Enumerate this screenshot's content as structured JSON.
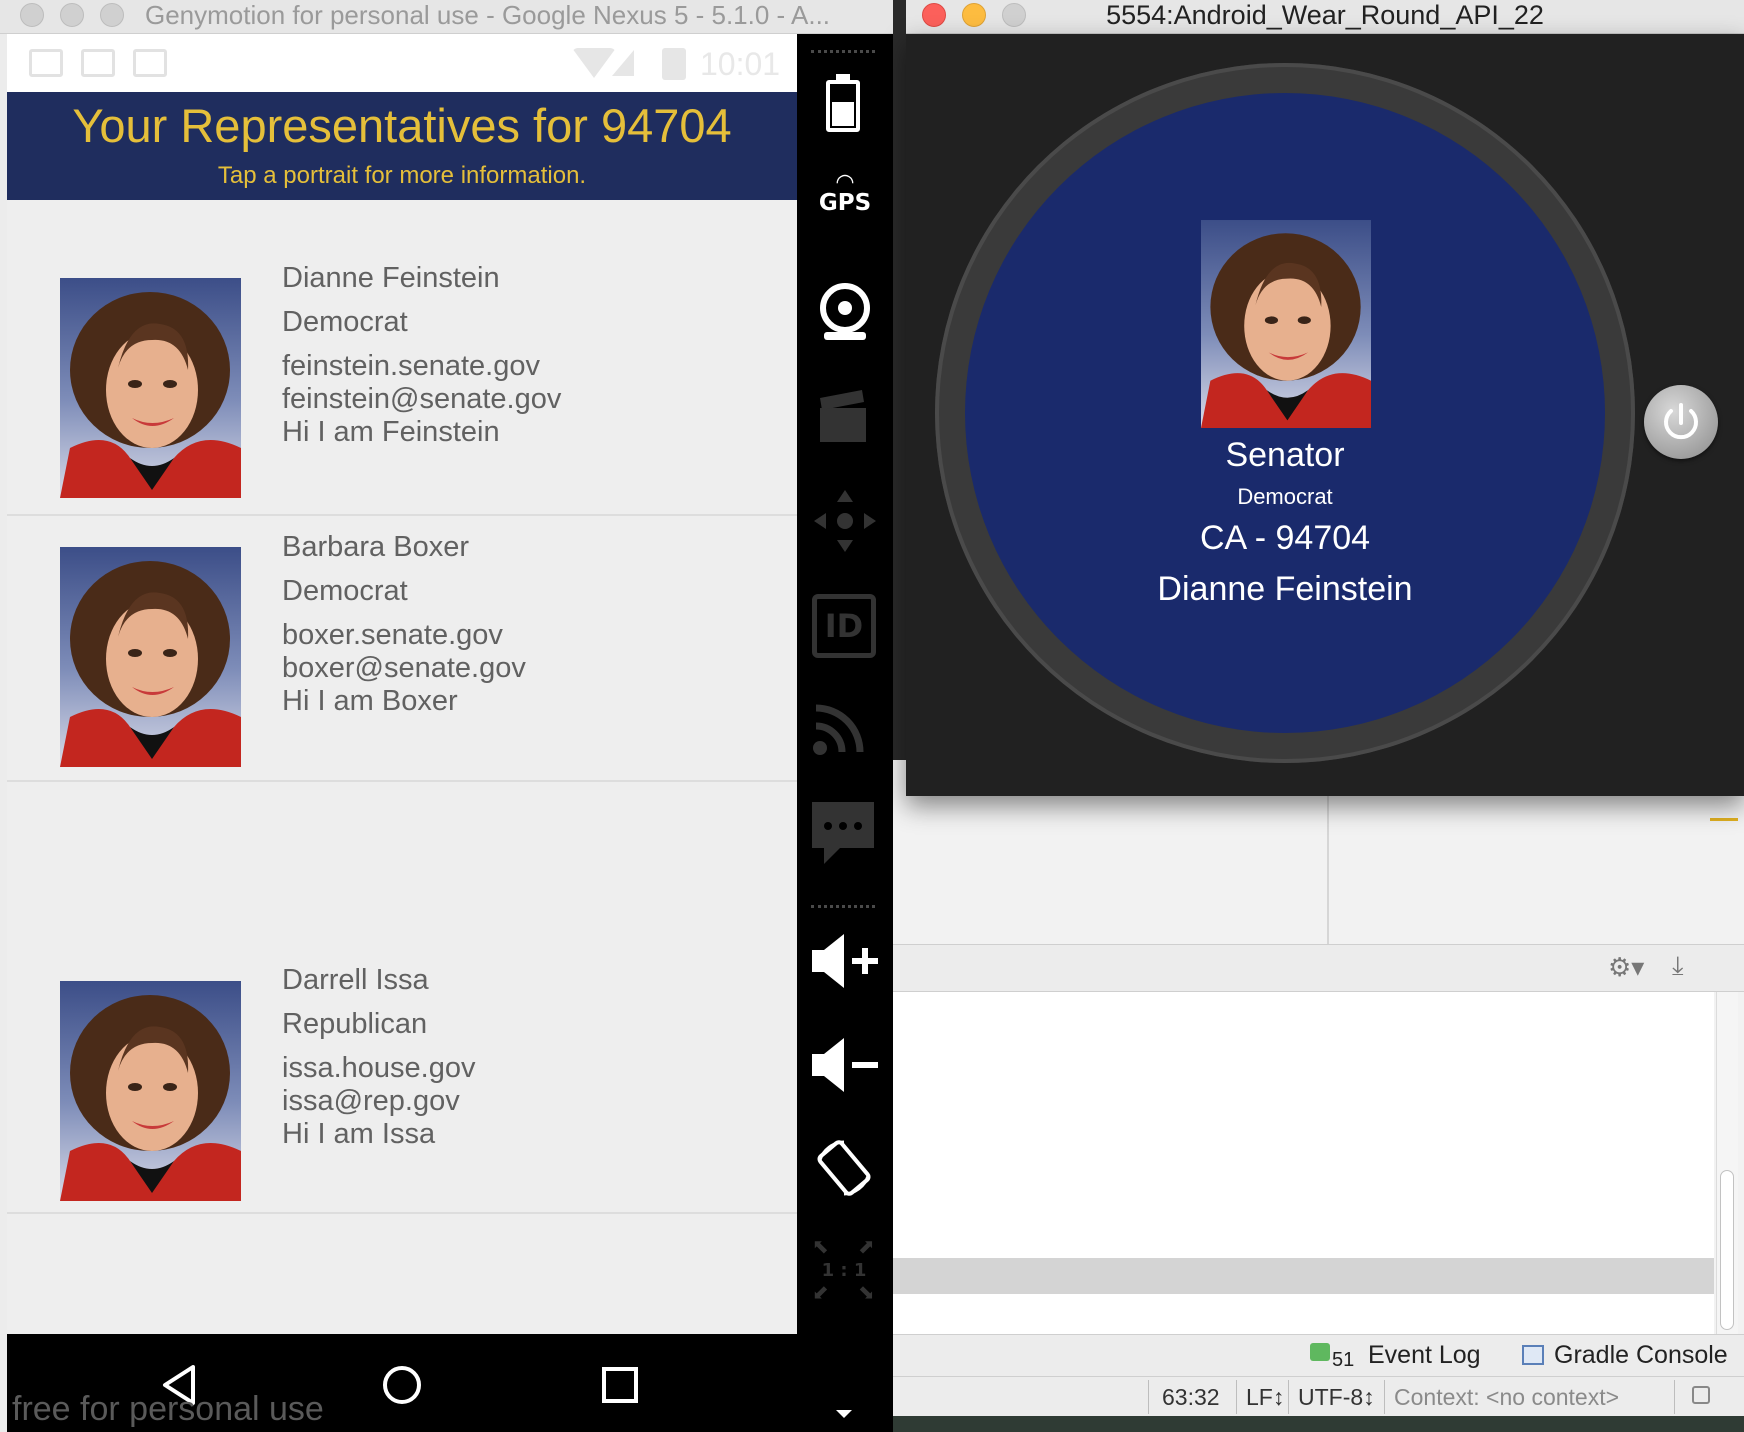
{
  "genymotion": {
    "window_title": "Genymotion for personal use - Google Nexus 5 - 5.1.0 - A...",
    "watermark": "free for personal use",
    "status_bar": {
      "time": "10:01"
    },
    "app": {
      "title": "Your Representatives for 94704",
      "subtitle": "Tap a portrait for more information."
    },
    "representatives": [
      {
        "name": "Dianne Feinstein",
        "party": "Democrat",
        "website": "feinstein.senate.gov",
        "email": "feinstein@senate.gov",
        "tweet": "Hi I am Feinstein"
      },
      {
        "name": "Barbara Boxer",
        "party": "Democrat",
        "website": "boxer.senate.gov",
        "email": "boxer@senate.gov",
        "tweet": "Hi I am Boxer"
      },
      {
        "name": "Darrell Issa",
        "party": "Republican",
        "website": "issa.house.gov",
        "email": "issa@rep.gov",
        "tweet": "Hi I am Issa"
      }
    ],
    "sidebar": {
      "gps_label": "GPS",
      "id_label": "ID",
      "scale_label": "1 : 1",
      "icons": [
        "battery-icon",
        "gps-icon",
        "webcam-icon",
        "capture-icon",
        "dpad-icon",
        "id-icon",
        "network-icon",
        "sms-icon",
        "volume-up-icon",
        "volume-down-icon",
        "rotate-icon",
        "scale-icon"
      ]
    },
    "navbar": {
      "icons": [
        "back-icon",
        "home-icon",
        "recents-icon"
      ]
    }
  },
  "wear": {
    "window_title": "5554:Android_Wear_Round_API_22",
    "title": "Senator",
    "party": "Democrat",
    "district": "CA - 94704",
    "name": "Dianne Feinstein"
  },
  "ide": {
    "event_log_count": "51",
    "event_log": "Event Log",
    "gradle_console": "Gradle Console",
    "status": {
      "position": "63:32",
      "line_sep": "LF↕",
      "encoding": "UTF-8↕",
      "context": "Context: <no context>"
    }
  },
  "colors": {
    "header_bg": "#1f2d5e",
    "header_text": "#e5bf3a",
    "watch_face": "#1a2a6c",
    "close_red": "#fc605b",
    "minimize_yellow": "#fdbc40"
  }
}
